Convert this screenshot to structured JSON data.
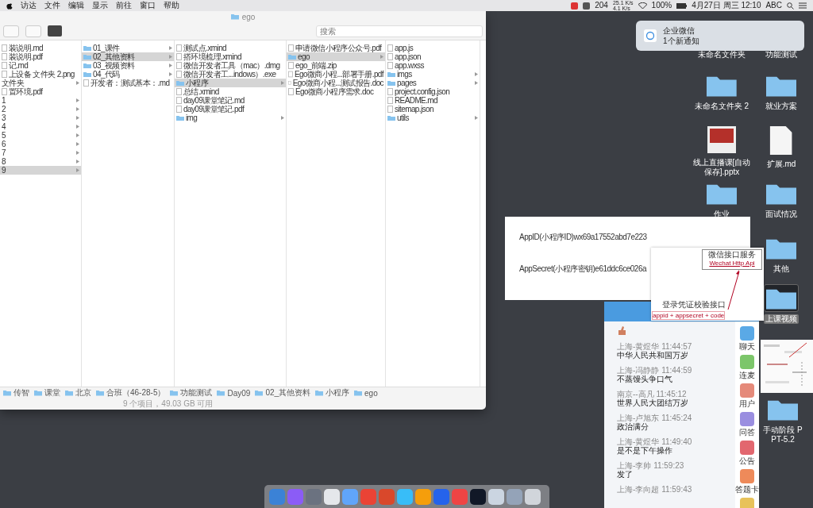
{
  "menu_bar": {
    "menus": [
      "访达",
      "文件",
      "编辑",
      "显示",
      "前往",
      "窗口",
      "帮助"
    ],
    "chat_count": "204",
    "net_up": "25.1 K/s",
    "net_down": "4.1 K/s",
    "battery": "100%",
    "clock": "4月27日 周三 12:10",
    "input_method": "ABC"
  },
  "finder": {
    "title": "ego",
    "search_placeholder": "搜索",
    "columns": [
      {
        "items": [
          {
            "name": "装说明.md",
            "kind": "file",
            "selected": false
          },
          {
            "name": "装说明.pdf",
            "kind": "file",
            "selected": false
          },
          {
            "name": "记.md",
            "kind": "file",
            "selected": false
          },
          {
            "name": "上设备 文件夹 2.png",
            "kind": "file",
            "selected": false
          },
          {
            "name": "文件夹",
            "kind": "file_folder",
            "selected": false
          },
          {
            "name": "置环境.pdf",
            "kind": "file",
            "selected": false
          },
          {
            "name": "1",
            "kind": "file_folder",
            "selected": false
          },
          {
            "name": "2",
            "kind": "file_folder",
            "selected": false
          },
          {
            "name": "3",
            "kind": "file_folder",
            "selected": false
          },
          {
            "name": "4",
            "kind": "file_folder",
            "selected": false
          },
          {
            "name": "5",
            "kind": "file_folder",
            "selected": false
          },
          {
            "name": "6",
            "kind": "file_folder",
            "selected": false
          },
          {
            "name": "7",
            "kind": "file_folder",
            "selected": false
          },
          {
            "name": "8",
            "kind": "file_folder",
            "selected": false
          },
          {
            "name": "9",
            "kind": "file_folder",
            "selected": true
          }
        ]
      },
      {
        "items": [
          {
            "name": "01_课件",
            "kind": "folder",
            "selected": false
          },
          {
            "name": "02_其他资料",
            "kind": "folder",
            "selected": true
          },
          {
            "name": "03_视频资料",
            "kind": "folder",
            "selected": false
          },
          {
            "name": "04_代码",
            "kind": "folder",
            "selected": false
          },
          {
            "name": "开发者：测试基本：.md",
            "kind": "file",
            "selected": false
          }
        ]
      },
      {
        "items": [
          {
            "name": "测试点.xmind",
            "kind": "file",
            "selected": false
          },
          {
            "name": "搭环境梳理.xmind",
            "kind": "file",
            "selected": false
          },
          {
            "name": "微信开发者工具（mac）.dmg",
            "kind": "file",
            "selected": false
          },
          {
            "name": "微信开发者工...indows）.exe",
            "kind": "file",
            "selected": false
          },
          {
            "name": "小程序",
            "kind": "folder",
            "selected": true
          },
          {
            "name": "总结.xmind",
            "kind": "file",
            "selected": false
          },
          {
            "name": "day09课堂笔记.md",
            "kind": "file",
            "selected": false
          },
          {
            "name": "day09课堂笔记.pdf",
            "kind": "file",
            "selected": false
          },
          {
            "name": "img",
            "kind": "folder",
            "selected": false
          }
        ]
      },
      {
        "items": [
          {
            "name": "申请微信小程序公众号.pdf",
            "kind": "file",
            "selected": false
          },
          {
            "name": "ego",
            "kind": "folder",
            "selected": true
          },
          {
            "name": "ego_前端.zip",
            "kind": "file",
            "selected": false
          },
          {
            "name": "Ego微商小程...部署手册.pdf",
            "kind": "file",
            "selected": false
          },
          {
            "name": "Ego微商小程...测试报告.doc",
            "kind": "file",
            "selected": false
          },
          {
            "name": "Ego微商小程序需求.doc",
            "kind": "file",
            "selected": false
          }
        ]
      },
      {
        "items": [
          {
            "name": "app.js",
            "kind": "file",
            "selected": false
          },
          {
            "name": "app.json",
            "kind": "file",
            "selected": false
          },
          {
            "name": "app.wxss",
            "kind": "file",
            "selected": false
          },
          {
            "name": "imgs",
            "kind": "folder",
            "selected": false
          },
          {
            "name": "pages",
            "kind": "folder",
            "selected": false
          },
          {
            "name": "project.config.json",
            "kind": "file",
            "selected": false
          },
          {
            "name": "README.md",
            "kind": "file",
            "selected": false
          },
          {
            "name": "sitemap.json",
            "kind": "file",
            "selected": false
          },
          {
            "name": "utils",
            "kind": "folder",
            "selected": false
          }
        ]
      }
    ],
    "path": [
      "传智",
      "课堂",
      "北京",
      "合班（46-28-5）",
      "功能测试",
      "Day09",
      "02_其他资料",
      "小程序",
      "ego"
    ],
    "status": "9 个项目，49.03 GB 可用"
  },
  "notification": {
    "app": "企业微信",
    "text": "1个新通知"
  },
  "desktop_icons": [
    {
      "label": "未命名文件夹",
      "kind": "covered",
      "selected": false
    },
    {
      "label": "功能测试",
      "kind": "covered",
      "selected": false
    },
    {
      "label": "未命名文件夹 2",
      "kind": "folder",
      "selected": false
    },
    {
      "label": "就业方案",
      "kind": "folder",
      "selected": false
    },
    {
      "label": "线上直播课[自动保存].pptx",
      "kind": "slides",
      "selected": false
    },
    {
      "label": "扩展.md",
      "kind": "text",
      "selected": false
    },
    {
      "label": "作业",
      "kind": "folder",
      "selected": false
    },
    {
      "label": "面试情况",
      "kind": "folder",
      "selected": false
    },
    {
      "label": "其他",
      "kind": "folder",
      "selected": false
    },
    {
      "label": "上课视频",
      "kind": "folder",
      "selected": true
    },
    {
      "kind": "picture"
    },
    {
      "label": "手动阶段 PPT-5.2",
      "kind": "folder",
      "selected": false
    }
  ],
  "slide": {
    "lines": [
      "AppID(小程序ID)wx69a17552abd7e223",
      "AppSecret(小程序密钥)e61ddc6ce026a"
    ]
  },
  "diagram": {
    "service": "微信接口服务",
    "api": "Wechat Http Api",
    "endpoint": "登录凭证校验接口",
    "params": "appid + appsecret + code"
  },
  "chat": {
    "messages": [
      {
        "sender": "上海-黄煜华",
        "time": "11:44:57",
        "text": "中华人民共和国万岁"
      },
      {
        "sender": "上海-冯静静",
        "time": "11:44:59",
        "text": "不蒸馒头争口气"
      },
      {
        "sender": "南京--高凡",
        "time": "11:45:12",
        "text": "世界人民大团结万岁"
      },
      {
        "sender": "上海-卢旭东",
        "time": "11:45:24",
        "text": "政治满分"
      },
      {
        "sender": "上海-黄煜华",
        "time": "11:49:40",
        "text": "是不是下午操作"
      },
      {
        "sender": "上海-李帅",
        "time": "11:59:23",
        "text": "发了"
      },
      {
        "sender": "上海-李向超",
        "time": "11:59:43"
      }
    ],
    "tabs": [
      {
        "label": "聊天",
        "color": "#5aa9e6"
      },
      {
        "label": "连麦",
        "color": "#7cc66a"
      },
      {
        "label": "用户",
        "color": "#e58a7a"
      },
      {
        "label": "问答",
        "color": "#9a8ee0"
      },
      {
        "label": "公告",
        "color": "#e2676f"
      },
      {
        "label": "答题卡",
        "color": "#ee8a5a"
      },
      {
        "color": "#e8c25a"
      }
    ]
  },
  "dock": [
    {
      "color": "#3b82d6"
    },
    {
      "color": "#8b5cf6"
    },
    {
      "color": "#6b7280"
    },
    {
      "color": "#e5e7eb"
    },
    {
      "color": "#60a5fa"
    },
    {
      "color": "#ea4335"
    },
    {
      "color": "#d9482b"
    },
    {
      "color": "#38bdf8"
    },
    {
      "color": "#f59e0b"
    },
    {
      "color": "#2563eb"
    },
    {
      "color": "#ef4444"
    },
    {
      "color": "#111827"
    },
    {
      "color": "#cbd5e1"
    },
    {
      "color": "#94a3b8"
    },
    {
      "color": "#d1d5db"
    }
  ]
}
